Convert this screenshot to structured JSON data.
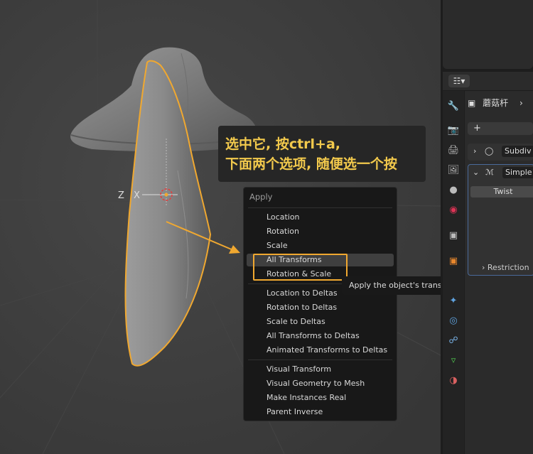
{
  "annotation": {
    "line1": "选中它, 按ctrl+a,",
    "line2": "下面两个选项, 随便选一个按"
  },
  "viewport": {
    "axis_z": "Z",
    "axis_x": "X",
    "colors": {
      "selection": "#f0a830",
      "background": "#3d3d3d",
      "mesh": "#8a8a8a"
    }
  },
  "apply_menu": {
    "title": "Apply",
    "groups": [
      [
        "Location",
        "Rotation",
        "Scale",
        "All Transforms",
        "Rotation & Scale"
      ],
      [
        "Location to Deltas",
        "Rotation to Deltas",
        "Scale to Deltas",
        "All Transforms to Deltas",
        "Animated Transforms to Deltas"
      ],
      [
        "Visual Transform",
        "Visual Geometry to Mesh",
        "Make Instances Real",
        "Parent Inverse"
      ]
    ],
    "highlighted": "All Transforms"
  },
  "tooltip": "Apply the object's transformation to its data.",
  "properties": {
    "object_name": "蘑菇杆",
    "add_modifier": "+",
    "modifiers": [
      {
        "name": "Subdiv",
        "icon": "subdivision-icon"
      },
      {
        "name": "Simple",
        "icon": "simple-deform-icon"
      }
    ],
    "twist_label": "Twist",
    "restrictions_label": "Restriction",
    "tabs": [
      "tool-icon",
      "render-icon",
      "output-icon",
      "view-layer-icon",
      "scene-icon",
      "world-icon",
      "collection-icon",
      "object-icon",
      "modifier-icon",
      "particles-icon",
      "physics-icon",
      "constraints-icon",
      "data-icon",
      "material-icon"
    ]
  }
}
